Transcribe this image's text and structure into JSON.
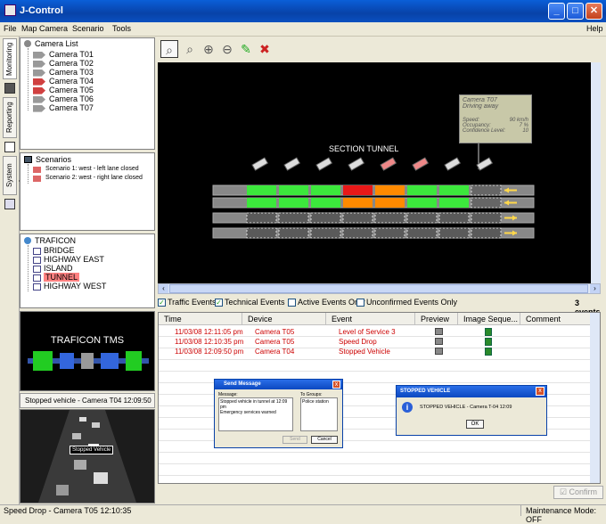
{
  "window": {
    "title": "J-Control",
    "controls": {
      "minimize": "_",
      "maximize": "□",
      "close": "✕"
    }
  },
  "menu": {
    "items": [
      "File",
      "Map",
      "Camera",
      "Scenario",
      "Tools"
    ],
    "help": "Help"
  },
  "side_tabs": [
    "Monitoring",
    "Reporting",
    "System Log"
  ],
  "camera_list": {
    "title": "Camera List",
    "cameras": [
      {
        "label": "Camera T01",
        "alert": false
      },
      {
        "label": "Camera T02",
        "alert": false
      },
      {
        "label": "Camera T03",
        "alert": false
      },
      {
        "label": "Camera T04",
        "alert": true
      },
      {
        "label": "Camera T05",
        "alert": true
      },
      {
        "label": "Camera T06",
        "alert": false
      },
      {
        "label": "Camera T07",
        "alert": false
      }
    ]
  },
  "scenarios": {
    "title": "Scenarios",
    "items": [
      "Scenario 1: west - left lane closed",
      "Scenario 2: west - right lane closed"
    ]
  },
  "traficon_tree": {
    "title": "TRAFICON",
    "items": [
      {
        "label": "BRIDGE",
        "selected": false
      },
      {
        "label": "HIGHWAY EAST",
        "selected": false
      },
      {
        "label": "ISLAND",
        "selected": false
      },
      {
        "label": "TUNNEL",
        "selected": true
      },
      {
        "label": "HIGHWAY WEST",
        "selected": false
      }
    ]
  },
  "minimap": {
    "title": "TRAFICON TMS"
  },
  "video": {
    "caption": "Stopped vehicle - Camera T04 12:09:50",
    "tag": "Stopped Vehicle"
  },
  "toolbar": {
    "icons": [
      "zoom-select-icon",
      "zoom-area-icon",
      "zoom-in-icon",
      "zoom-out-icon",
      "edit-icon",
      "delete-icon"
    ]
  },
  "map_view": {
    "section_label": "SECTION TUNNEL",
    "tooltip": {
      "camera": "Camera T07",
      "status": "Driving away",
      "rows": [
        {
          "label": "Speed:",
          "value": "90 km/h"
        },
        {
          "label": "Occupancy:",
          "value": "7 %"
        },
        {
          "label": "Confidence Level:",
          "value": "10"
        }
      ]
    },
    "cameras": [
      "normal",
      "normal",
      "normal",
      "normal",
      "alert",
      "alert",
      "normal",
      "normal"
    ],
    "lane1_segments": [
      "#3ce83c",
      "#3ce83c",
      "#3ce83c",
      "#e81818",
      "#ff8a00",
      "#3ce83c",
      "#3ce83c",
      "empty"
    ],
    "lane2_segments": [
      "#3ce83c",
      "#3ce83c",
      "#3ce83c",
      "#ff8a00",
      "#ff8a00",
      "#3ce83c",
      "#3ce83c",
      "empty"
    ],
    "arrow_color": "#ffd84a"
  },
  "filters": {
    "items": [
      {
        "label": "Traffic Events",
        "checked": true
      },
      {
        "label": "Technical Events",
        "checked": true
      },
      {
        "label": "Active Events Only",
        "checked": false
      },
      {
        "label": "Unconfirmed Events Only",
        "checked": false
      }
    ],
    "count": "3 events"
  },
  "events_table": {
    "columns": [
      "Time",
      "Device",
      "Event",
      "Preview",
      "Image Seque...",
      "Comment"
    ],
    "rows": [
      {
        "time": "11/03/08 12:11:05 pm",
        "device": "Camera T05",
        "event": "Level of Service 3"
      },
      {
        "time": "11/03/08 12:10:35 pm",
        "device": "Camera T05",
        "event": "Speed Drop"
      },
      {
        "time": "11/03/08 12:09:50 pm",
        "device": "Camera T04",
        "event": "Stopped Vehicle"
      }
    ]
  },
  "send_message_dialog": {
    "title": "Send Message",
    "message_label": "Message:",
    "message_text": "Stopped vehicle in tunnel at 12:09 pm\nEmergency services warned",
    "groups_label": "To Groups:",
    "group": "Police station",
    "send": "Send",
    "cancel": "Cancel"
  },
  "alert_dialog": {
    "title": "STOPPED VEHICLE",
    "text": "STOPPED VEHICLE - Camera T-04 12:09",
    "ok": "OK"
  },
  "confirm_button": "Confirm",
  "status": {
    "left": "Speed Drop - Camera T05 12:10:35",
    "right": "Maintenance Mode: OFF"
  },
  "colors": {
    "titlebar": "#0a50c0",
    "alert_red": "#c00000",
    "selection": "#ff8080"
  }
}
